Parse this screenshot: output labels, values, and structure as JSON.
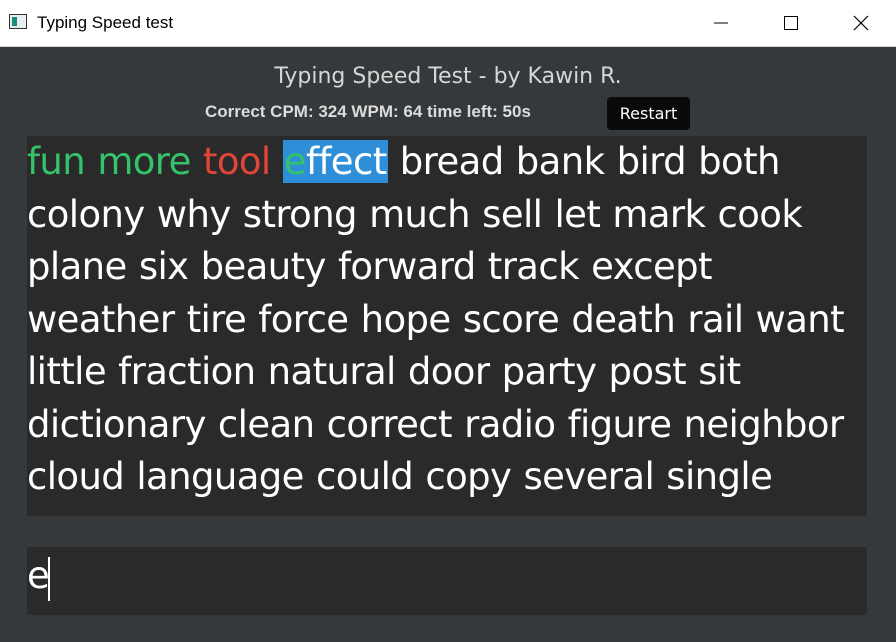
{
  "window": {
    "title": "Typing Speed test"
  },
  "header": {
    "heading": "Typing Speed Test - by Kawin R.",
    "stats": "Correct CPM: 324 WPM: 64 time left: 50s",
    "restart_label": "Restart"
  },
  "passage": {
    "typed_words": [
      {
        "text": "fun",
        "status": "correct"
      },
      {
        "text": "more",
        "status": "correct"
      },
      {
        "text": "tool",
        "status": "incorrect"
      }
    ],
    "current_word": {
      "typed": "e",
      "remaining": "ffect"
    },
    "upcoming_text": "bread bank bird both colony why strong much sell let mark cook plane six beauty forward track except weather tire force hope score death rail want little fraction natural door party post sit dictionary clean correct radio figure neighbor cloud language could copy several single",
    "colors": {
      "correct": "#33c36a",
      "incorrect": "#e0453a",
      "current_highlight": "#2e8fd8"
    }
  },
  "input": {
    "value": "e"
  }
}
